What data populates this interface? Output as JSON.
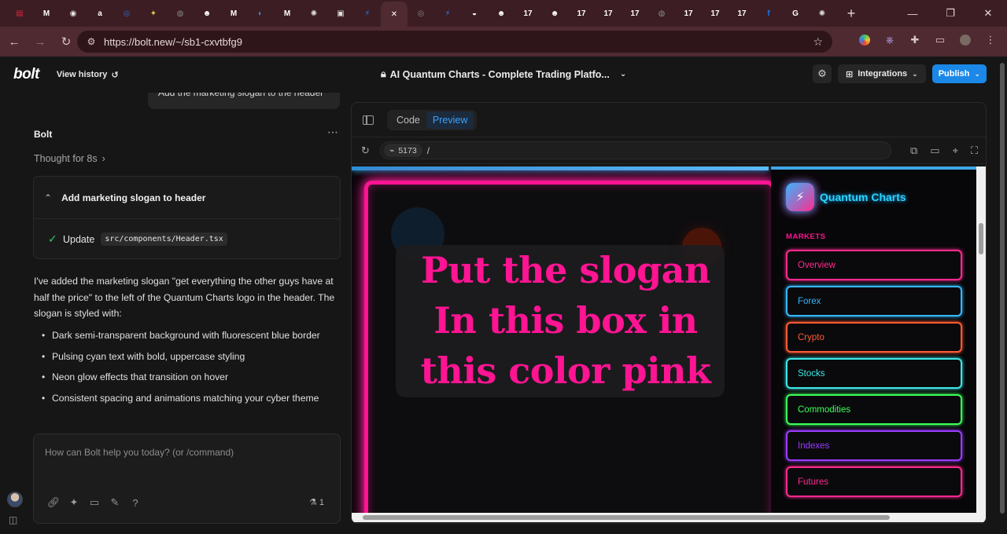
{
  "browser": {
    "url": "https://bolt.new/~/sb1-cxvtbfg9",
    "tabs": [
      {
        "icon": "chart-icon",
        "color": "#d9263b",
        "glyph": "▤"
      },
      {
        "icon": "gmail-icon",
        "color": "#ffffff",
        "glyph": "M"
      },
      {
        "icon": "tab-icon",
        "color": "#e6e6e6",
        "glyph": "◉"
      },
      {
        "icon": "amazon-icon",
        "color": "#ffffff",
        "glyph": "a"
      },
      {
        "icon": "tab-icon",
        "color": "#2d6fd4",
        "glyph": "◎"
      },
      {
        "icon": "tab-icon",
        "color": "#e8c34a",
        "glyph": "✦"
      },
      {
        "icon": "tab-icon",
        "color": "#888888",
        "glyph": "◍"
      },
      {
        "icon": "copilot-icon",
        "color": "#ffffff",
        "glyph": "☻"
      },
      {
        "icon": "gmail-icon",
        "color": "#ffffff",
        "glyph": "M"
      },
      {
        "icon": "tab-icon",
        "color": "#3c8cd6",
        "glyph": "◐"
      },
      {
        "icon": "gmail-icon",
        "color": "#ffffff",
        "glyph": "M"
      },
      {
        "icon": "openai-icon",
        "color": "#dddddd",
        "glyph": "✺"
      },
      {
        "icon": "tab-icon",
        "color": "#dddddd",
        "glyph": "▣"
      },
      {
        "icon": "bolt-icon",
        "color": "#2c7ef0",
        "glyph": "⚡"
      },
      {
        "icon": "close-icon",
        "color": "#ffffff",
        "glyph": "✕",
        "active": true
      },
      {
        "icon": "tab-icon",
        "color": "#888888",
        "glyph": "◎"
      },
      {
        "icon": "bolt-icon",
        "color": "#2c7ef0",
        "glyph": "⚡"
      },
      {
        "icon": "github-icon",
        "color": "#ffffff",
        "glyph": "◒"
      },
      {
        "icon": "copilot-icon",
        "color": "#ffffff",
        "glyph": "☻"
      },
      {
        "icon": "tradingview-icon",
        "color": "#ffffff",
        "glyph": "17"
      },
      {
        "icon": "copilot-icon",
        "color": "#ffffff",
        "glyph": "☻"
      },
      {
        "icon": "tradingview-icon",
        "color": "#ffffff",
        "glyph": "17"
      },
      {
        "icon": "tradingview-icon",
        "color": "#ffffff",
        "glyph": "17"
      },
      {
        "icon": "tradingview-icon",
        "color": "#ffffff",
        "glyph": "17"
      },
      {
        "icon": "tab-icon",
        "color": "#888888",
        "glyph": "◍"
      },
      {
        "icon": "tradingview-icon",
        "color": "#ffffff",
        "glyph": "17"
      },
      {
        "icon": "tradingview-icon",
        "color": "#ffffff",
        "glyph": "17"
      },
      {
        "icon": "tradingview-icon",
        "color": "#ffffff",
        "glyph": "17"
      },
      {
        "icon": "facebook-icon",
        "color": "#1877f2",
        "glyph": "f"
      },
      {
        "icon": "tab-icon",
        "color": "#ffffff",
        "glyph": "G"
      },
      {
        "icon": "openai-icon",
        "color": "#dddddd",
        "glyph": "✺"
      }
    ]
  },
  "bolt": {
    "logo": "bolt",
    "view_history": "View history",
    "project_title": "AI Quantum Charts - Complete Trading Platfo...",
    "integrations": "Integrations",
    "publish": "Publish"
  },
  "chat": {
    "user_message": "Add the marketing slogan to the header",
    "assistant_name": "Bolt",
    "thought": "Thought for 8s",
    "action_title": "Add marketing slogan to header",
    "action_verb": "Update",
    "action_file": "src/components/Header.tsx",
    "reply_paragraph": "I've added the marketing slogan \"get everything the other guys have at half the price\" to the left of the Quantum Charts logo in the header. The slogan is styled with:",
    "bullets": [
      "Dark semi-transparent background with fluorescent blue border",
      "Pulsing cyan text with bold, uppercase styling",
      "Neon glow effects that transition on hover",
      "Consistent spacing and animations matching your cyber theme"
    ],
    "prompt_placeholder": "How can Bolt help you today? (or /command)",
    "prompt_count": "1"
  },
  "preview": {
    "tabs": [
      "Code",
      "Preview"
    ],
    "active_tab": "Preview",
    "port": "5173",
    "path": "/",
    "slogan_lines": [
      "Put the slogan",
      "In this box in",
      "this color pink"
    ],
    "slogan_color": "#ff1493",
    "app_title": "Quantum Charts",
    "markets_label": "MARKETS",
    "markets": [
      {
        "label": "Overview",
        "color": "#ff2a8f"
      },
      {
        "label": "Forex",
        "color": "#38b6ff"
      },
      {
        "label": "Crypto",
        "color": "#ff5a36"
      },
      {
        "label": "Stocks",
        "color": "#3ee6e6"
      },
      {
        "label": "Commodities",
        "color": "#3cff5a"
      },
      {
        "label": "Indexes",
        "color": "#9b3cff"
      },
      {
        "label": "Futures",
        "color": "#ff2a8f"
      }
    ]
  }
}
